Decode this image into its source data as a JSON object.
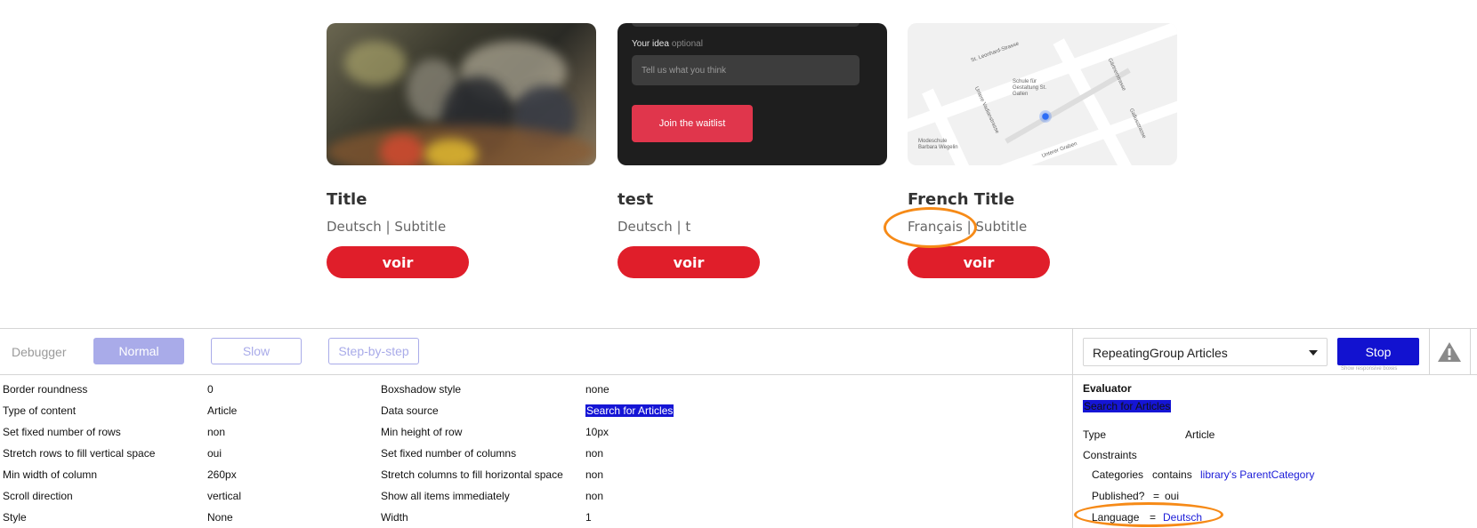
{
  "cards": [
    {
      "title": "Title",
      "subtitle": "Deutsch | Subtitle",
      "button": "voir"
    },
    {
      "title": "test",
      "subtitle": "Deutsch | t",
      "button": "voir"
    },
    {
      "title": "French Title",
      "subtitle": "Français | Subtitle",
      "button": "voir"
    }
  ],
  "form_card": {
    "label": "Your idea",
    "optional": "optional",
    "placeholder": "Tell us what you think",
    "button": "Join the waitlist"
  },
  "map_card": {
    "streets": [
      "St. Leonhard-Strasse",
      "Gärtnerstrasse",
      "Gallusstrasse",
      "Untere Vadianstrasse",
      "Unterer Graben"
    ],
    "poi_1": "Schule für Gestaltung St. Gallen",
    "poi_2": "Modeschule Barbara Wegelin"
  },
  "debugger": {
    "label": "Debugger",
    "modes": {
      "normal": "Normal",
      "slow": "Slow",
      "step": "Step-by-step"
    },
    "element_select": "RepeatingGroup Articles",
    "stop": "Stop",
    "hint": "Show responsive boxes"
  },
  "properties": {
    "left": [
      {
        "name": "Border roundness",
        "value": "0"
      },
      {
        "name": "Type of content",
        "value": "Article"
      },
      {
        "name": "Set fixed number of rows",
        "value": "non"
      },
      {
        "name": "Stretch rows to fill vertical space",
        "value": "oui"
      },
      {
        "name": "Min width of column",
        "value": "260px"
      },
      {
        "name": "Scroll direction",
        "value": "vertical"
      },
      {
        "name": "Style",
        "value": "None"
      }
    ],
    "right": [
      {
        "name": "Boxshadow style",
        "value": "none"
      },
      {
        "name": "Data source",
        "value": "Search for Articles"
      },
      {
        "name": "Min height of row",
        "value": "10px"
      },
      {
        "name": "Set fixed number of columns",
        "value": "non"
      },
      {
        "name": "Stretch columns to fill horizontal space",
        "value": "non"
      },
      {
        "name": "Show all items immediately",
        "value": "non"
      },
      {
        "name": "Width",
        "value": "1"
      }
    ]
  },
  "evaluator": {
    "title": "Evaluator",
    "expression": "Search for Articles",
    "type_label": "Type",
    "type_value": "Article",
    "constraints_label": "Constraints",
    "constraints": [
      {
        "field": "Categories",
        "op": "contains",
        "value": "library's ParentCategory"
      },
      {
        "field": "Published?",
        "op": "=",
        "value": "oui"
      },
      {
        "field": "Language",
        "op": "=",
        "value": "Deutsch"
      }
    ]
  },
  "colors": {
    "accent_red": "#e01e2a",
    "highlight_oval": "#f68a17",
    "stop_blue": "#1212d0",
    "mode_purple": "#a9abe9"
  }
}
